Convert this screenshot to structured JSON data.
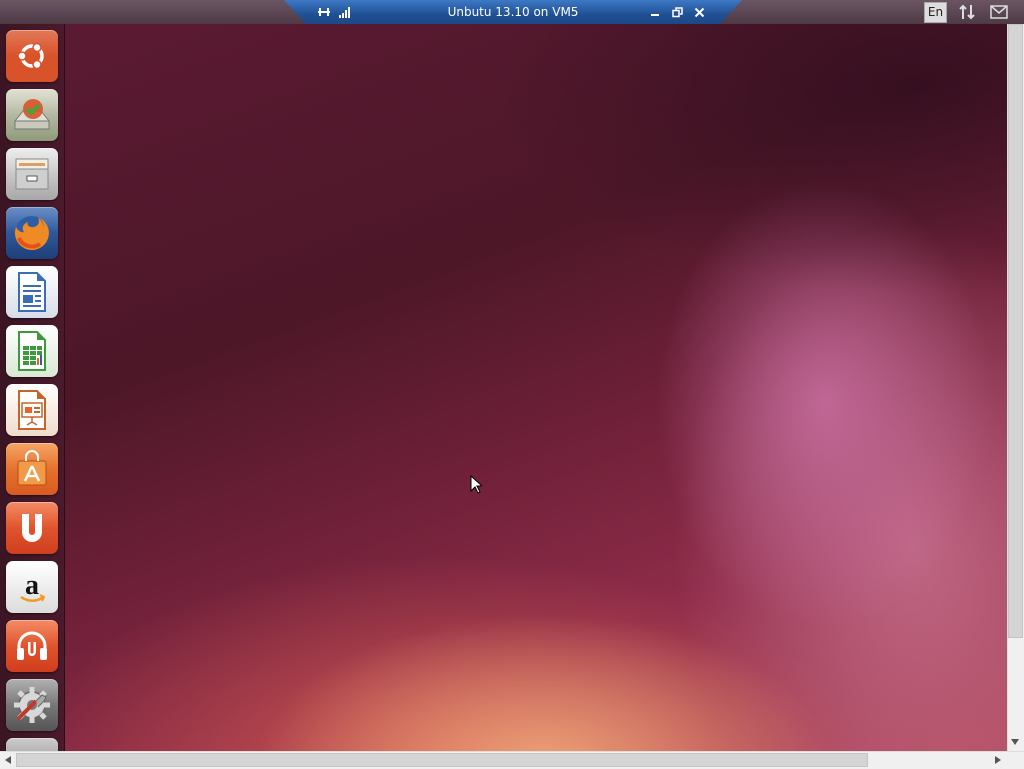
{
  "window": {
    "connection_title": "Unbutu 13.10 on VM5"
  },
  "indicators": {
    "keyboard_layout": "En"
  },
  "launcher": {
    "items": [
      {
        "name": "Dash home",
        "icon": "ubuntu-logo-icon",
        "color": "#d9532a"
      },
      {
        "name": "Backup / Installer",
        "icon": "drive-install-icon",
        "color": "#a6b38c"
      },
      {
        "name": "Files",
        "icon": "file-cabinet-icon",
        "color": "#bdbdbd"
      },
      {
        "name": "Firefox Web Browser",
        "icon": "firefox-icon",
        "color": "#e8722a"
      },
      {
        "name": "LibreOffice Writer",
        "icon": "writer-document-icon",
        "color": "#3a6db4"
      },
      {
        "name": "LibreOffice Calc",
        "icon": "calc-spreadsheet-icon",
        "color": "#3d9a3c"
      },
      {
        "name": "LibreOffice Impress",
        "icon": "impress-presentation-icon",
        "color": "#c6652a"
      },
      {
        "name": "Ubuntu Software Center",
        "icon": "software-center-bag-icon",
        "color": "#e8622a"
      },
      {
        "name": "Ubuntu One",
        "icon": "ubuntu-one-icon",
        "color": "#e0532a"
      },
      {
        "name": "Amazon",
        "icon": "amazon-icon",
        "color": "#ffffff"
      },
      {
        "name": "Ubuntu One Music",
        "icon": "headphones-icon",
        "color": "#e0532a"
      },
      {
        "name": "System Settings",
        "icon": "settings-gear-wrench-icon",
        "color": "#888888"
      },
      {
        "name": "Device",
        "icon": "device-icon",
        "color": "#999999"
      }
    ]
  },
  "colors": {
    "connection_bar": "#2a5fa8",
    "desktop_base": "#5b1a33",
    "desktop_glow": "#f0a578"
  }
}
